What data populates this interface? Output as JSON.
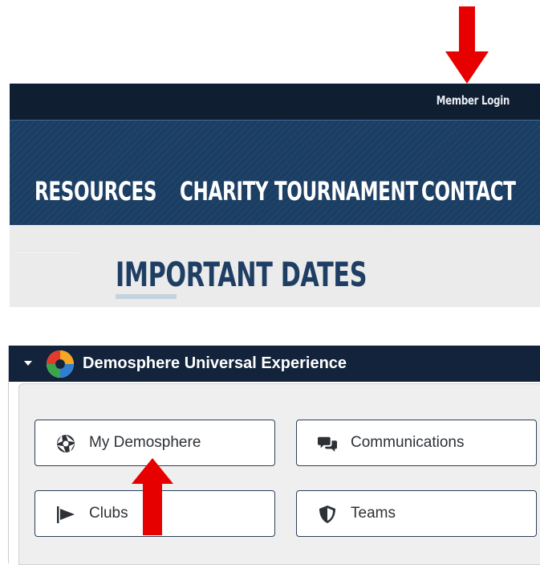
{
  "site": {
    "member_login": "Member Login",
    "nav": [
      "RESOURCES",
      "CHARITY TOURNAMENT",
      "CONTACT"
    ],
    "section_title": "IMPORTANT DATES"
  },
  "panel": {
    "title": "Demosphere Universal Experience",
    "tiles": {
      "my_demosphere": "My Demosphere",
      "communications": "Communications",
      "clubs": "Clubs",
      "teams": "Teams"
    }
  },
  "colors": {
    "arrow": "#e60000",
    "nav_bg": "#1b3d61",
    "panel_header": "#13233c"
  },
  "icons": [
    "caret-down-icon",
    "demosphere-logo-icon",
    "aperture-icon",
    "chat-bubbles-icon",
    "flag-icon",
    "shield-icon",
    "arrow-down-icon",
    "arrow-up-icon"
  ]
}
